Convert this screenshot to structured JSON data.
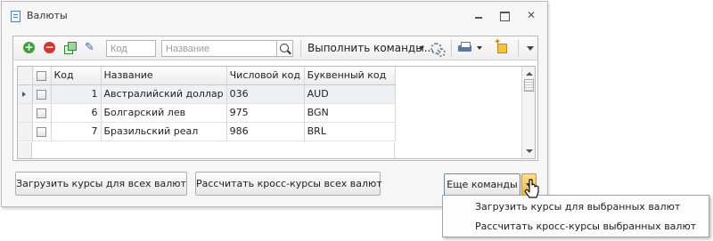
{
  "window": {
    "title": "Валюты"
  },
  "toolbar": {
    "code_placeholder": "Код",
    "name_placeholder": "Название",
    "execute_label": "Выполнить команды..."
  },
  "grid": {
    "columns": [
      "Код",
      "Название",
      "Числовой код",
      "Буквенный код"
    ],
    "rows": [
      {
        "code": "1",
        "name": "Австралийский доллар",
        "numeric": "036",
        "letter": "AUD"
      },
      {
        "code": "6",
        "name": "Болгарский лев",
        "numeric": "975",
        "letter": "BGN"
      },
      {
        "code": "7",
        "name": "Бразильский реал",
        "numeric": "986",
        "letter": "BRL"
      }
    ]
  },
  "buttons": {
    "load_rates": "Загрузить курсы для всех валют",
    "cross_rates": "Рассчитать кросс-курсы всех валют",
    "more_commands": "Еще команды"
  },
  "menu": {
    "items": [
      "Загрузить курсы для выбранных валют",
      "Рассчитать кросс-курсы выбранных валют"
    ]
  },
  "icons": {
    "add": "add-icon",
    "delete": "delete-icon",
    "copy": "copy-icon",
    "edit": "edit-icon",
    "search": "search-icon",
    "commands": "gears-icon",
    "print": "printer-icon",
    "settings": "settings-icon"
  },
  "colors": {
    "add": "#3aa43a",
    "delete": "#d9342b",
    "dropdown_highlight": "#f5b93a"
  }
}
